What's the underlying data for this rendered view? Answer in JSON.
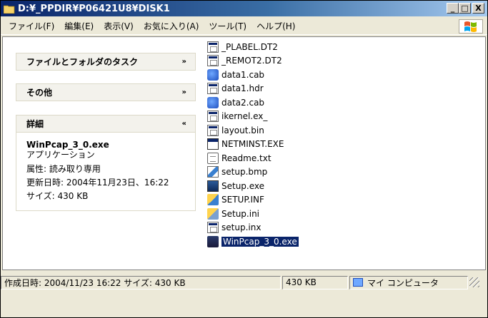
{
  "window": {
    "title": "D:¥_PPDIR¥P06421U8¥DISK1",
    "minimize": "_",
    "maximize": "□",
    "close": "X"
  },
  "menu": [
    "ファイル(F)",
    "編集(E)",
    "表示(V)",
    "お気に入り(A)",
    "ツール(T)",
    "ヘルプ(H)"
  ],
  "taskpane": {
    "file_tasks": {
      "title": "ファイルとフォルダのタスク",
      "chevron": "»"
    },
    "other": {
      "title": "その他",
      "chevron": "»"
    },
    "details": {
      "title": "詳細",
      "chevron": "«",
      "name": "WinPcap_3_0.exe",
      "type": "アプリケーション",
      "attr": "属性: 読み取り専用",
      "modified": "更新日時: 2004年11月23日、16:22",
      "size": "サイズ: 430 KB"
    }
  },
  "files": [
    {
      "name": "_PLABEL.DT2",
      "icon": "document-icon"
    },
    {
      "name": "_REMOT2.DT2",
      "icon": "document-icon"
    },
    {
      "name": "data1.cab",
      "icon": "cab-icon"
    },
    {
      "name": "data1.hdr",
      "icon": "document-icon"
    },
    {
      "name": "data2.cab",
      "icon": "cab-icon"
    },
    {
      "name": "ikernel.ex_",
      "icon": "document-icon"
    },
    {
      "name": "layout.bin",
      "icon": "document-icon"
    },
    {
      "name": "NETMINST.EXE",
      "icon": "exe-icon"
    },
    {
      "name": "Readme.txt",
      "icon": "text-icon"
    },
    {
      "name": "setup.bmp",
      "icon": "bitmap-icon"
    },
    {
      "name": "Setup.exe",
      "icon": "setup-icon"
    },
    {
      "name": "SETUP.INF",
      "icon": "inf-icon"
    },
    {
      "name": "Setup.ini",
      "icon": "ini-icon"
    },
    {
      "name": "setup.inx",
      "icon": "document-icon"
    },
    {
      "name": "WinPcap_3_0.exe",
      "icon": "winpcap-icon",
      "selected": true
    }
  ],
  "status": {
    "info": "作成日時: 2004/11/23 16:22 サイズ: 430 KB",
    "size": "430 KB",
    "location": "マイ コンピュータ"
  }
}
